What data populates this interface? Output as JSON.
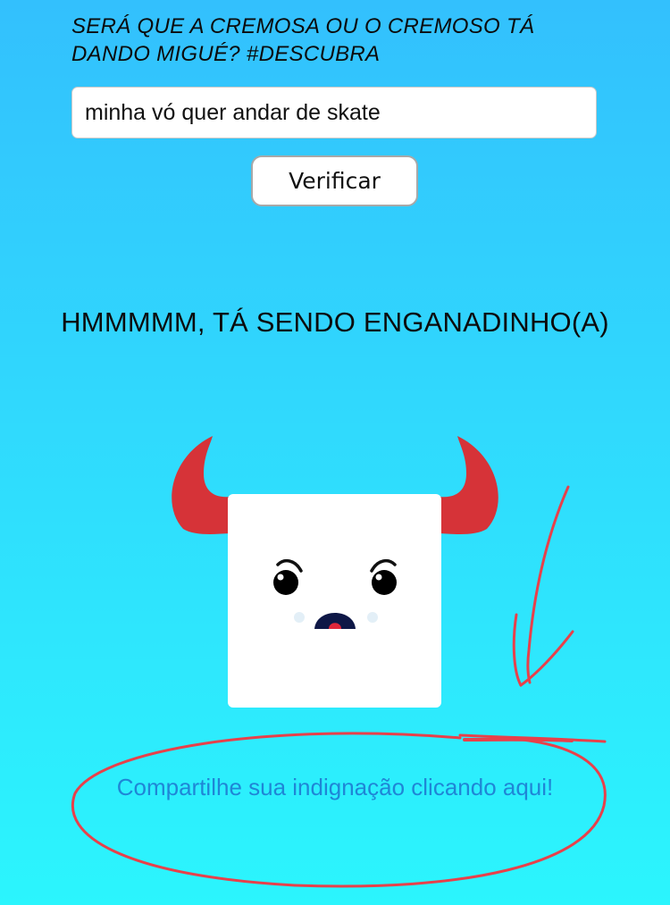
{
  "headline": {
    "line1": "SERÁ QUE A CREMOSA OU O CREMOSO TÁ",
    "line2": "DANDO MIGUÉ? #DESCUBRA"
  },
  "message_input": {
    "value": "minha vó quer andar de skate"
  },
  "verify_button": {
    "label": "Verificar"
  },
  "result": {
    "text": "HMMMMM, TÁ SENDO ENGANADINHO(A)"
  },
  "mascot": {
    "icon": "angry-devil-cube-icon",
    "horn_color": "#D63338",
    "face_color": "#FFFFFF"
  },
  "share_link": {
    "text": "Compartilhe sua indignação clicando aqui!",
    "color": "#1F86D6"
  },
  "annotation": {
    "color": "#E8404A"
  }
}
